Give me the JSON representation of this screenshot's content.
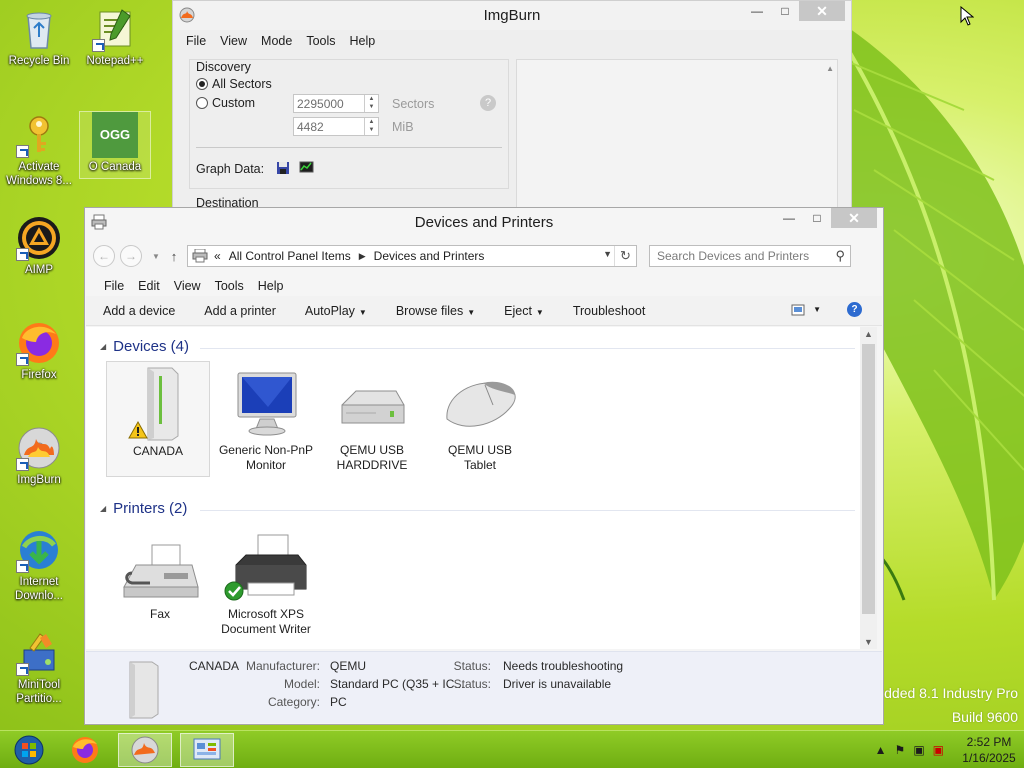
{
  "desktop": {
    "icons": [
      {
        "label": "Recycle Bin",
        "icon": "recycle-bin-icon"
      },
      {
        "label": "Notepad++",
        "icon": "notepad-plus-plus-icon"
      },
      {
        "label": "Activate Windows 8...",
        "icon": "activate-key-icon"
      },
      {
        "label": "O Canada",
        "icon": "ogg-file-icon",
        "badge": "OGG"
      },
      {
        "label": "AIMP",
        "icon": "aimp-icon"
      },
      {
        "label": "Firefox",
        "icon": "firefox-icon"
      },
      {
        "label": "ImgBurn",
        "icon": "imgburn-icon"
      },
      {
        "label": "Internet Downlo...",
        "icon": "internet-download-manager-icon"
      },
      {
        "label": "MiniTool Partitio...",
        "icon": "minitool-partition-icon"
      }
    ],
    "watermark": {
      "line1": "dded 8.1 Industry Pro",
      "line2": "Build 9600"
    }
  },
  "imgburn": {
    "title": "ImgBurn",
    "menu": [
      "File",
      "View",
      "Mode",
      "Tools",
      "Help"
    ],
    "discovery_label": "Discovery",
    "all_sectors_label": "All Sectors",
    "custom_label": "Custom",
    "sectors_value": "2295000",
    "sectors_unit": "Sectors",
    "mib_value": "4482",
    "mib_unit": "MiB",
    "graph_data_label": "Graph Data:",
    "destination_label": "Destination"
  },
  "devices": {
    "title": "Devices and Printers",
    "breadcrumb": [
      "All Control Panel Items",
      "Devices and Printers"
    ],
    "breadcrumb_prefix": "«",
    "search_placeholder": "Search Devices and Printers",
    "menu": [
      "File",
      "Edit",
      "View",
      "Tools",
      "Help"
    ],
    "commands": [
      {
        "label": "Add a device",
        "dropdown": false
      },
      {
        "label": "Add a printer",
        "dropdown": false
      },
      {
        "label": "AutoPlay",
        "dropdown": true
      },
      {
        "label": "Browse files",
        "dropdown": true
      },
      {
        "label": "Eject",
        "dropdown": true
      },
      {
        "label": "Troubleshoot",
        "dropdown": false
      }
    ],
    "devices_header": "Devices (4)",
    "printers_header": "Printers (2)",
    "device_items": [
      {
        "line1": "CANADA",
        "line2": "",
        "icon": "computer-tower-warning-icon"
      },
      {
        "line1": "Generic Non-PnP",
        "line2": "Monitor",
        "icon": "monitor-icon"
      },
      {
        "line1": "QEMU USB",
        "line2": "HARDDRIVE",
        "icon": "hard-drive-icon"
      },
      {
        "line1": "QEMU USB",
        "line2": "Tablet",
        "icon": "mouse-icon"
      }
    ],
    "printer_items": [
      {
        "line1": "Fax",
        "line2": "",
        "icon": "fax-icon"
      },
      {
        "line1": "Microsoft XPS",
        "line2": "Document Writer",
        "icon": "printer-default-icon"
      }
    ],
    "details": {
      "name": "CANADA",
      "manufacturer_label": "Manufacturer:",
      "manufacturer": "QEMU",
      "model_label": "Model:",
      "model": "Standard PC (Q35 + IC...",
      "category_label": "Category:",
      "category": "PC",
      "status_label": "Status:",
      "status": "Needs troubleshooting",
      "status2_label": "Status:",
      "status2": "Driver is unavailable"
    }
  },
  "taskbar": {
    "time": "2:52 PM",
    "date": "1/16/2025",
    "apps": [
      "start-button",
      "firefox-icon",
      "imgburn-icon",
      "control-panel-icon"
    ]
  },
  "colors": {
    "accent": "#1e3287",
    "taskbar": "#7fbd1c",
    "desktop": "#b5dc2a"
  }
}
